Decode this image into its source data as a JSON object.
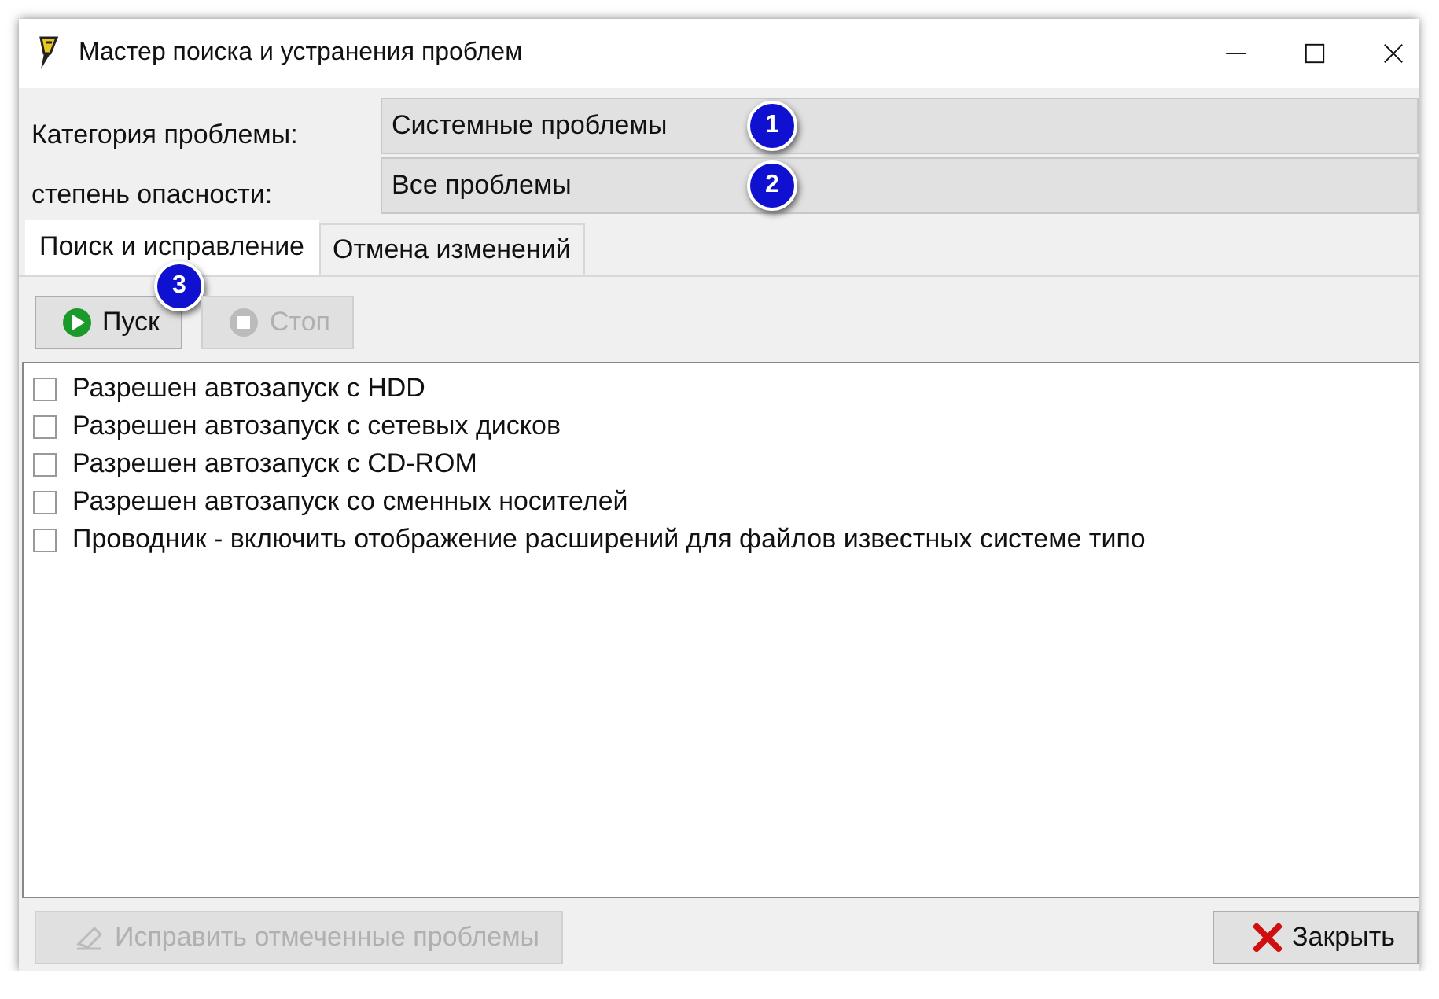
{
  "window": {
    "title": "Мастер поиска и устранения проблем"
  },
  "filters": [
    {
      "label": "Категория проблемы:",
      "value": "Системные проблемы",
      "badge": "1"
    },
    {
      "label": "степень опасности:",
      "value": "Все проблемы",
      "badge": "2"
    }
  ],
  "tabs": [
    {
      "label": "Поиск и исправление",
      "selected": true
    },
    {
      "label": "Отмена изменений",
      "selected": false
    }
  ],
  "toolbar": [
    {
      "kind": "start",
      "label": "Пуск",
      "disabled": false,
      "badge": "3"
    },
    {
      "kind": "stop",
      "label": "Стоп",
      "disabled": true
    }
  ],
  "items": [
    {
      "label": "Разрешен автозапуск с HDD",
      "checked": false
    },
    {
      "label": "Разрешен автозапуск с сетевых дисков",
      "checked": false
    },
    {
      "label": "Разрешен автозапуск с CD-ROM",
      "checked": false
    },
    {
      "label": "Разрешен автозапуск со сменных носителей",
      "checked": false
    },
    {
      "label": "Проводник - включить отображение расширений для файлов известных системе типо",
      "checked": false
    }
  ],
  "footer": [
    {
      "kind": "fix",
      "label": "Исправить отмеченные проблемы",
      "disabled": true
    },
    {
      "kind": "close",
      "label": "Закрыть",
      "disabled": false
    }
  ]
}
